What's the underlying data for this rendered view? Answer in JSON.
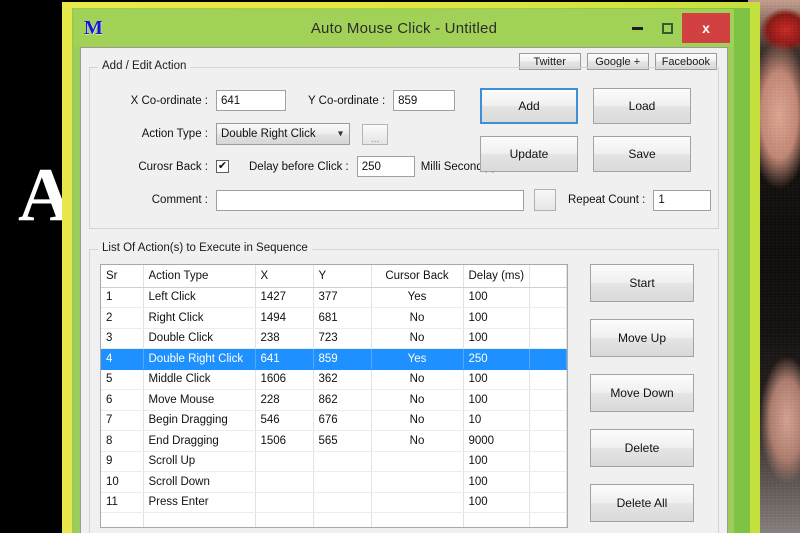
{
  "window": {
    "title": "Auto Mouse Click - Untitled",
    "app_icon": "M",
    "minimize_label": "–",
    "maximize_label": "□",
    "close_label": "x",
    "accent_titlebar": "#a2d158",
    "accent_close": "#d14141",
    "accent_selection": "#1e90ff"
  },
  "social": {
    "twitter": "Twitter",
    "google_plus": "Google +",
    "facebook": "Facebook"
  },
  "add_edit": {
    "group_title": "Add / Edit Action",
    "x_label": "X Co-ordinate :",
    "x_value": "641",
    "y_label": "Y Co-ordinate :",
    "y_value": "859",
    "action_type_label": "Action Type :",
    "action_type_value": "Double Right Click",
    "action_type_chevron": "chevron-down-icon",
    "browse_label": "...",
    "cursor_back_label": "Curosr Back :",
    "cursor_back_checked": "✔",
    "delay_label": "Delay before Click :",
    "delay_value": "250",
    "delay_unit": "Milli Second(s)",
    "comment_label": "Comment :",
    "comment_value": "",
    "repeat_label": "Repeat Count :",
    "repeat_value": "1"
  },
  "form_buttons": {
    "add": "Add",
    "load": "Load",
    "update": "Update",
    "save": "Save"
  },
  "sequence": {
    "group_title": "List Of Action(s) to Execute in Sequence",
    "columns": [
      "Sr",
      "Action Type",
      "X",
      "Y",
      "Cursor Back",
      "Delay (ms)"
    ],
    "rows": [
      {
        "sr": "1",
        "action": "Left Click",
        "x": "1427",
        "y": "377",
        "cursor_back": "Yes",
        "delay": "100",
        "selected": false
      },
      {
        "sr": "2",
        "action": "Right Click",
        "x": "1494",
        "y": "681",
        "cursor_back": "No",
        "delay": "100",
        "selected": false
      },
      {
        "sr": "3",
        "action": "Double Click",
        "x": "238",
        "y": "723",
        "cursor_back": "No",
        "delay": "100",
        "selected": false
      },
      {
        "sr": "4",
        "action": "Double Right Click",
        "x": "641",
        "y": "859",
        "cursor_back": "Yes",
        "delay": "250",
        "selected": true
      },
      {
        "sr": "5",
        "action": "Middle Click",
        "x": "1606",
        "y": "362",
        "cursor_back": "No",
        "delay": "100",
        "selected": false
      },
      {
        "sr": "6",
        "action": "Move Mouse",
        "x": "228",
        "y": "862",
        "cursor_back": "No",
        "delay": "100",
        "selected": false
      },
      {
        "sr": "7",
        "action": "Begin Dragging",
        "x": "546",
        "y": "676",
        "cursor_back": "No",
        "delay": "10",
        "selected": false
      },
      {
        "sr": "8",
        "action": "End Dragging",
        "x": "1506",
        "y": "565",
        "cursor_back": "No",
        "delay": "9000",
        "selected": false
      },
      {
        "sr": "9",
        "action": "Scroll Up",
        "x": "",
        "y": "",
        "cursor_back": "",
        "delay": "100",
        "selected": false
      },
      {
        "sr": "10",
        "action": "Scroll Down",
        "x": "",
        "y": "",
        "cursor_back": "",
        "delay": "100",
        "selected": false
      },
      {
        "sr": "11",
        "action": "Press Enter",
        "x": "",
        "y": "",
        "cursor_back": "",
        "delay": "100",
        "selected": false
      }
    ],
    "buttons": {
      "start": "Start",
      "move_up": "Move Up",
      "move_down": "Move Down",
      "delete": "Delete",
      "delete_all": "Delete All"
    }
  },
  "background": {
    "watermark_letter": "A"
  }
}
